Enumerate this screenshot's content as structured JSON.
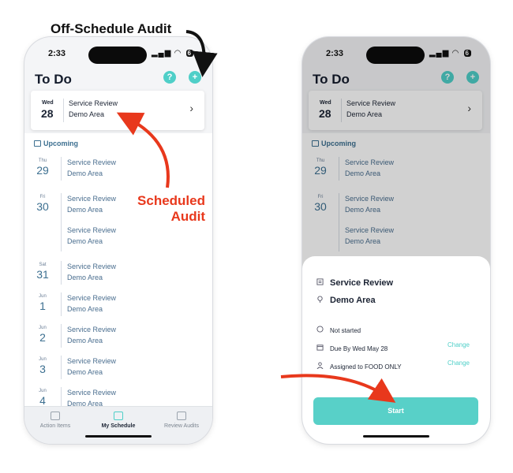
{
  "annotations": {
    "off_schedule": "Off-Schedule Audit",
    "scheduled_line1": "Scheduled",
    "scheduled_line2": "Audit"
  },
  "colors": {
    "accent": "#4fcfc8",
    "link": "#3c6f90",
    "annotation_red": "#e8381c"
  },
  "status": {
    "time": "2:33",
    "battery": "6"
  },
  "header": {
    "title": "To Do",
    "help_icon": "?",
    "add_icon": "+"
  },
  "today": {
    "dow": "Wed",
    "day": "28",
    "title": "Service Review",
    "area": "Demo Area"
  },
  "upcoming_label": "Upcoming",
  "groups": [
    {
      "dow": "Thu",
      "day": "29",
      "items": [
        {
          "title": "Service Review",
          "area": "Demo Area"
        }
      ]
    },
    {
      "dow": "Fri",
      "day": "30",
      "items": [
        {
          "title": "Service Review",
          "area": "Demo Area"
        },
        {
          "title": "Service Review",
          "area": "Demo Area"
        }
      ]
    },
    {
      "dow": "Sat",
      "day": "31",
      "items": [
        {
          "title": "Service Review",
          "area": "Demo Area"
        }
      ]
    },
    {
      "dow": "Jun",
      "day": "1",
      "items": [
        {
          "title": "Service Review",
          "area": "Demo Area"
        }
      ]
    },
    {
      "dow": "Jun",
      "day": "2",
      "items": [
        {
          "title": "Service Review",
          "area": "Demo Area"
        }
      ]
    },
    {
      "dow": "Jun",
      "day": "3",
      "items": [
        {
          "title": "Service Review",
          "area": "Demo Area"
        }
      ]
    },
    {
      "dow": "Jun",
      "day": "4",
      "items": [
        {
          "title": "Service Review",
          "area": "Demo Area"
        }
      ]
    }
  ],
  "tabs": [
    {
      "label": "Action Items",
      "icon": "home-icon"
    },
    {
      "label": "My Schedule",
      "icon": "calendar-icon"
    },
    {
      "label": "Review Audits",
      "icon": "review-icon"
    }
  ],
  "sheet": {
    "title": "Service Review",
    "area": "Demo Area",
    "status": "Not started",
    "due": "Due By Wed May 28",
    "assigned": "Assigned to FOOD ONLY",
    "change_label": "Change",
    "start_label": "Start"
  }
}
